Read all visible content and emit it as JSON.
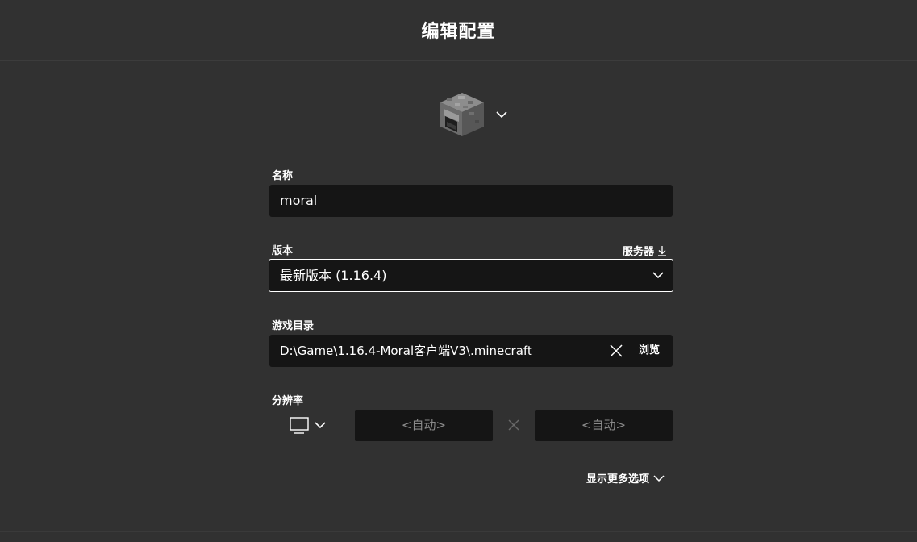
{
  "header": {
    "title": "编辑配置"
  },
  "icon_picker": {
    "icon": "furnace-icon",
    "dropdown": "chevron-down-icon"
  },
  "name": {
    "label": "名称",
    "value": "moral"
  },
  "version": {
    "label": "版本",
    "server_link": "服务器",
    "server_icon": "download-arrow-icon",
    "selected": "最新版本 (1.16.4)"
  },
  "game_dir": {
    "label": "游戏目录",
    "value": "D:\\Game\\1.16.4-Moral客户端V3\\.minecraft",
    "browse": "浏览",
    "clear_icon": "close-icon"
  },
  "resolution": {
    "label": "分辨率",
    "monitor_icon": "monitor-icon",
    "width_placeholder": "<自动>",
    "height_placeholder": "<自动>",
    "separator_icon": "times-icon"
  },
  "more_options": {
    "label": "显示更多选项"
  },
  "colors": {
    "background": "#313131",
    "field": "#151515",
    "text": "#ffffff",
    "muted": "#8a8a8a"
  }
}
